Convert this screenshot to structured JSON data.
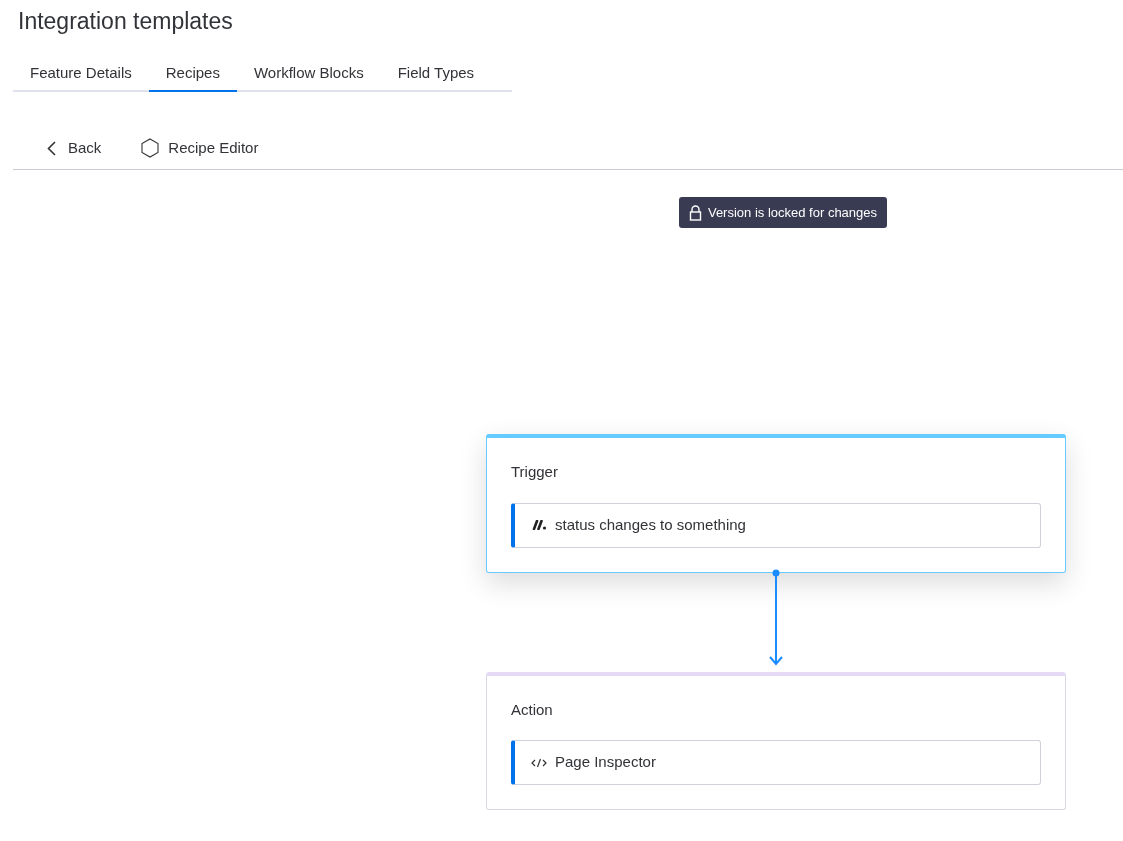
{
  "page": {
    "title": "Integration templates"
  },
  "tabs": [
    {
      "label": "Feature Details",
      "selected": false
    },
    {
      "label": "Recipes",
      "selected": true
    },
    {
      "label": "Workflow Blocks",
      "selected": false
    },
    {
      "label": "Field Types",
      "selected": false
    }
  ],
  "toolbar": {
    "back": "Back",
    "editor": "Recipe Editor"
  },
  "lock_banner": "Version is locked for changes",
  "nodes": [
    {
      "kind": "trigger",
      "title": "Trigger",
      "color": "#66ccff",
      "selected": true,
      "step": {
        "label": "status changes to something"
      }
    },
    {
      "kind": "action",
      "title": "Action",
      "color": "#e5daf5",
      "selected": false,
      "step": {
        "label": "Page Inspector"
      }
    }
  ]
}
